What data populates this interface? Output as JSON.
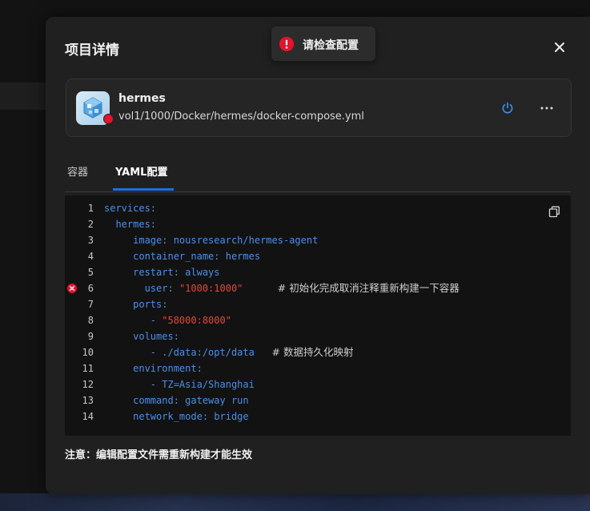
{
  "modal": {
    "title": "项目详情",
    "note": "注意：编辑配置文件需重新构建才能生效"
  },
  "toast": {
    "message": "请检查配置",
    "icon": "error-icon",
    "color": "#e5132b"
  },
  "project": {
    "name": "hermes",
    "path": "vol1/1000/Docker/hermes/docker-compose.yml",
    "status_color": "#e5132b",
    "status": "error"
  },
  "tabs": [
    {
      "label": "容器",
      "active": false
    },
    {
      "label": "YAML配置",
      "active": true
    }
  ],
  "colors": {
    "accent": "#1f6fe0",
    "yaml_key": "#4c8fe8",
    "yaml_string": "#e0483d",
    "error": "#e5132b"
  },
  "editor": {
    "error_line": 6,
    "lines": [
      {
        "n": "1",
        "indent": "",
        "key": "services:",
        "str": "",
        "rest": "",
        "comment": ""
      },
      {
        "n": "2",
        "indent": "  ",
        "key": "hermes:",
        "str": "",
        "rest": "",
        "comment": ""
      },
      {
        "n": "3",
        "indent": "     ",
        "key": "image: nousresearch/hermes-agent",
        "str": "",
        "rest": "",
        "comment": ""
      },
      {
        "n": "4",
        "indent": "     ",
        "key": "container_name: hermes",
        "str": "",
        "rest": "",
        "comment": ""
      },
      {
        "n": "5",
        "indent": "     ",
        "key": "restart: always",
        "str": "",
        "rest": "",
        "comment": ""
      },
      {
        "n": "6",
        "indent": "       ",
        "key": "user: ",
        "str": "\"1000:1000\"",
        "rest": "      ",
        "comment": "# 初始化完成取消注释重新构建一下容器"
      },
      {
        "n": "7",
        "indent": "     ",
        "key": "ports:",
        "str": "",
        "rest": "",
        "comment": ""
      },
      {
        "n": "8",
        "indent": "        ",
        "key": "- ",
        "str": "\"58000:8000\"",
        "rest": "",
        "comment": ""
      },
      {
        "n": "9",
        "indent": "     ",
        "key": "volumes:",
        "str": "",
        "rest": "",
        "comment": ""
      },
      {
        "n": "10",
        "indent": "        ",
        "key": "- ./data:/opt/data",
        "str": "",
        "rest": "   ",
        "comment": "# 数据持久化映射"
      },
      {
        "n": "11",
        "indent": "     ",
        "key": "environment:",
        "str": "",
        "rest": "",
        "comment": ""
      },
      {
        "n": "12",
        "indent": "        ",
        "key": "- TZ=Asia/Shanghai",
        "str": "",
        "rest": "",
        "comment": ""
      },
      {
        "n": "13",
        "indent": "     ",
        "key": "command: gateway run",
        "str": "",
        "rest": "",
        "comment": ""
      },
      {
        "n": "14",
        "indent": "     ",
        "key": "network_mode: bridge",
        "str": "",
        "rest": "",
        "comment": ""
      }
    ]
  }
}
